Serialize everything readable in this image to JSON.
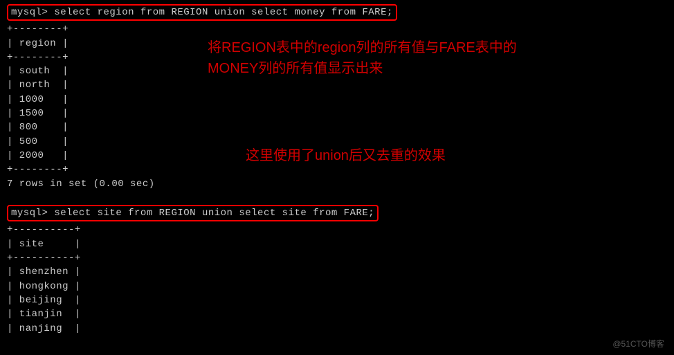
{
  "query1": {
    "prompt": "mysql> ",
    "sql": "select region from REGION union select money from FARE;"
  },
  "table1": {
    "border_top": "+--------+",
    "header": "| region |",
    "border_mid": "+--------+",
    "rows": [
      "| south  |",
      "| north  |",
      "| 1000   |",
      "| 1500   |",
      "| 800    |",
      "| 500    |",
      "| 2000   |"
    ],
    "border_bottom": "+--------+",
    "result": "7 rows in set (0.00 sec)"
  },
  "query2": {
    "prompt": "mysql> ",
    "sql": "select site from REGION union select site from FARE;"
  },
  "table2": {
    "border_top": "+----------+",
    "header": "| site     |",
    "border_mid": "+----------+",
    "rows": [
      "| shenzhen |",
      "| hongkong |",
      "| beijing  |",
      "| tianjin  |",
      "| nanjing  |"
    ]
  },
  "annotation1_line1": "将REGION表中的region列的所有值与FARE表中的",
  "annotation1_line2": "MONEY列的所有值显示出来",
  "annotation2": "这里使用了union后又去重的效果",
  "watermark": "@51CTO博客"
}
